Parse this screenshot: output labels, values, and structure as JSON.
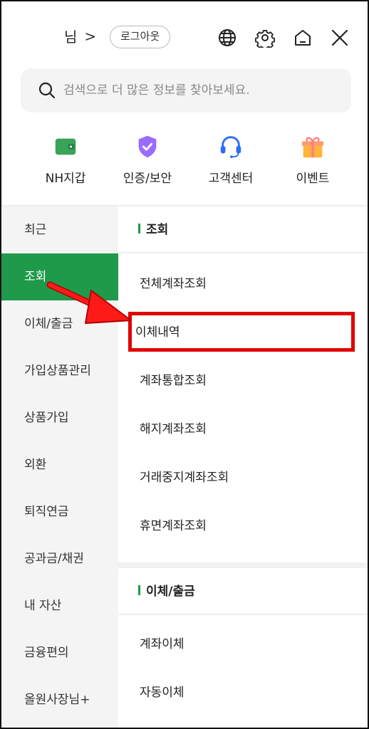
{
  "header": {
    "user_suffix": "님",
    "chevron": ">",
    "logout_label": "로그아웃",
    "icons": [
      "globe-icon",
      "gear-icon",
      "home-icon",
      "close-icon"
    ]
  },
  "search": {
    "placeholder": "검색으로 더 많은 정보를 찾아보세요."
  },
  "quick_menu": [
    {
      "label": "NH지갑",
      "icon": "wallet-icon",
      "color": "#3aa35a"
    },
    {
      "label": "인증/보안",
      "icon": "shield-check-icon",
      "color": "#9a6bff"
    },
    {
      "label": "고객센터",
      "icon": "headset-icon",
      "color": "#2d6df5"
    },
    {
      "label": "이벤트",
      "icon": "gift-icon",
      "color": "#ffb43a"
    }
  ],
  "left_nav": [
    {
      "label": "최근"
    },
    {
      "label": "조회"
    },
    {
      "label": "이체/출금"
    },
    {
      "label": "가입상품관리"
    },
    {
      "label": "상품가입"
    },
    {
      "label": "외환"
    },
    {
      "label": "퇴직연금"
    },
    {
      "label": "공과금/채권"
    },
    {
      "label": "내 자산"
    },
    {
      "label": "금융편의"
    },
    {
      "label": "올원사장님+"
    }
  ],
  "sections": [
    {
      "title": "조회",
      "items": [
        "전체계좌조회",
        "이체내역",
        "계좌통합조회",
        "해지계좌조회",
        "거래중지계좌조회",
        "휴면계좌조회"
      ]
    },
    {
      "title": "이체/출금",
      "items": [
        "계좌이체",
        "자동이체"
      ]
    }
  ],
  "colors": {
    "accent": "#1e9a4a",
    "highlight": "#e10000"
  }
}
